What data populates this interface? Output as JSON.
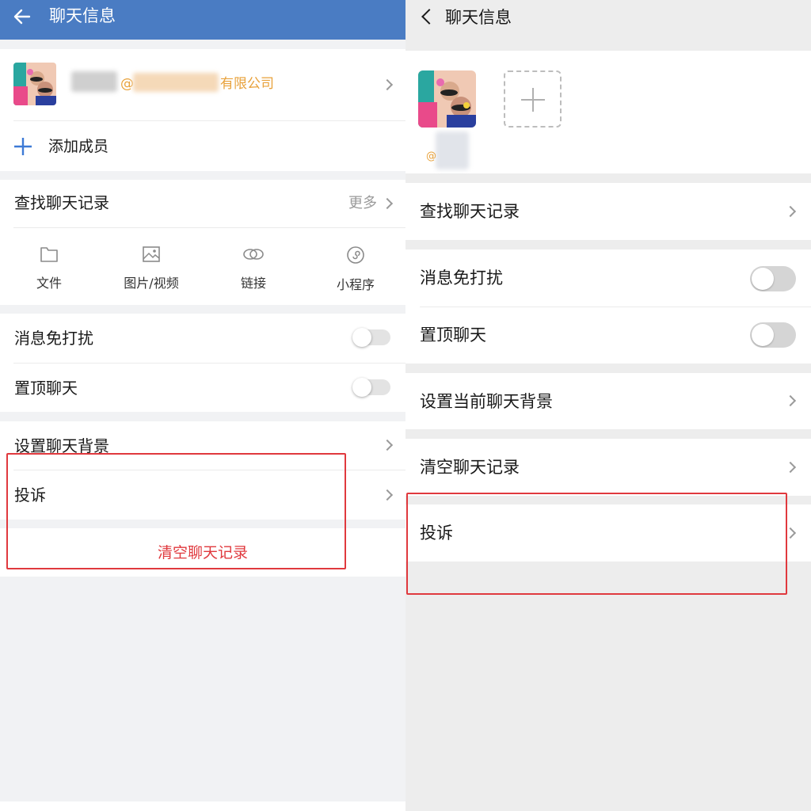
{
  "left": {
    "header": {
      "title": "聊天信息",
      "bg_color": "#4a7cc3"
    },
    "member": {
      "name_suffix": "@",
      "company": "有限公司"
    },
    "add_member_label": "添加成员",
    "search_history": {
      "label": "查找聊天记录",
      "more": "更多"
    },
    "media": [
      {
        "label": "文件",
        "icon": "folder-icon"
      },
      {
        "label": "图片/视频",
        "icon": "image-icon"
      },
      {
        "label": "链接",
        "icon": "link-icon"
      },
      {
        "label": "小程序",
        "icon": "mini-program-icon"
      }
    ],
    "mute_label": "消息免打扰",
    "pin_label": "置顶聊天",
    "background_label": "设置聊天背景",
    "complaint_label": "投诉",
    "clear_label": "清空聊天记录"
  },
  "right": {
    "header": {
      "title": "聊天信息"
    },
    "member": {
      "name": "@"
    },
    "search_history_label": "查找聊天记录",
    "mute_label": "消息免打扰",
    "pin_label": "置顶聊天",
    "background_label": "设置当前聊天背景",
    "clear_label": "清空聊天记录",
    "complaint_label": "投诉"
  },
  "colors": {
    "accent_blue": "#4a7cc3",
    "orange": "#e8a13a",
    "danger_red": "#e0393e",
    "highlight_box": "#e0393e"
  }
}
